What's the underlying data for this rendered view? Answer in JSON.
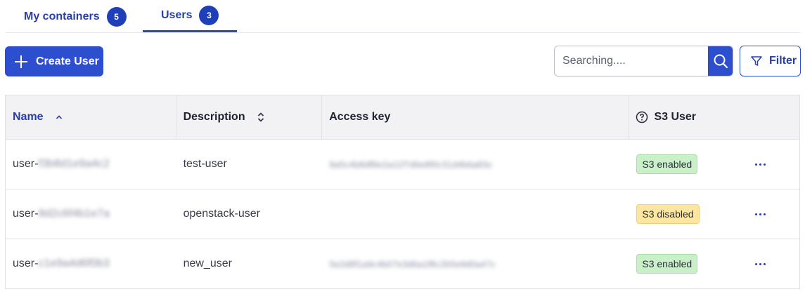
{
  "tabs": [
    {
      "label": "My containers",
      "count": "5"
    },
    {
      "label": "Users",
      "count": "3",
      "active": true
    }
  ],
  "toolbar": {
    "create_label": "Create User",
    "search_placeholder": "Searching....",
    "filter_label": "Filter"
  },
  "table": {
    "headers": {
      "name": "Name",
      "description": "Description",
      "access_key": "Access key",
      "s3_user": "S3 User"
    },
    "rows": [
      {
        "name_prefix": "user-",
        "name_hidden": "f3b8d1e9a4c2",
        "description": "test-user",
        "access_key": "9a5c4b8df8e2a11f7d6e8f0c31d4b6a83c",
        "s3_status": "S3 enabled",
        "status_type": "enabled"
      },
      {
        "name_prefix": "user-",
        "name_hidden": "8d2c6f4b1e7a",
        "description": "openstack-user",
        "access_key": "",
        "s3_status": "S3 disabled",
        "status_type": "disabled"
      },
      {
        "name_prefix": "user-",
        "name_hidden": "c1e9a4d6f0b3",
        "description": "new_user",
        "access_key": "5e2d8f1a9c4b07e3d6a1f8c2b5e9d0a47c",
        "s3_status": "S3 enabled",
        "status_type": "enabled"
      }
    ]
  },
  "colors": {
    "primary": "#2c4ecf",
    "badge_enabled": "#c9f0c9",
    "badge_disabled": "#fde7a0"
  },
  "icons": {
    "create": "plus-icon",
    "search": "search-icon",
    "filter": "filter-icon",
    "sort_name": "chevron-up-icon",
    "sort_description": "sort-icon",
    "help": "question-circle-icon",
    "row_menu": "more-horizontal-icon"
  }
}
